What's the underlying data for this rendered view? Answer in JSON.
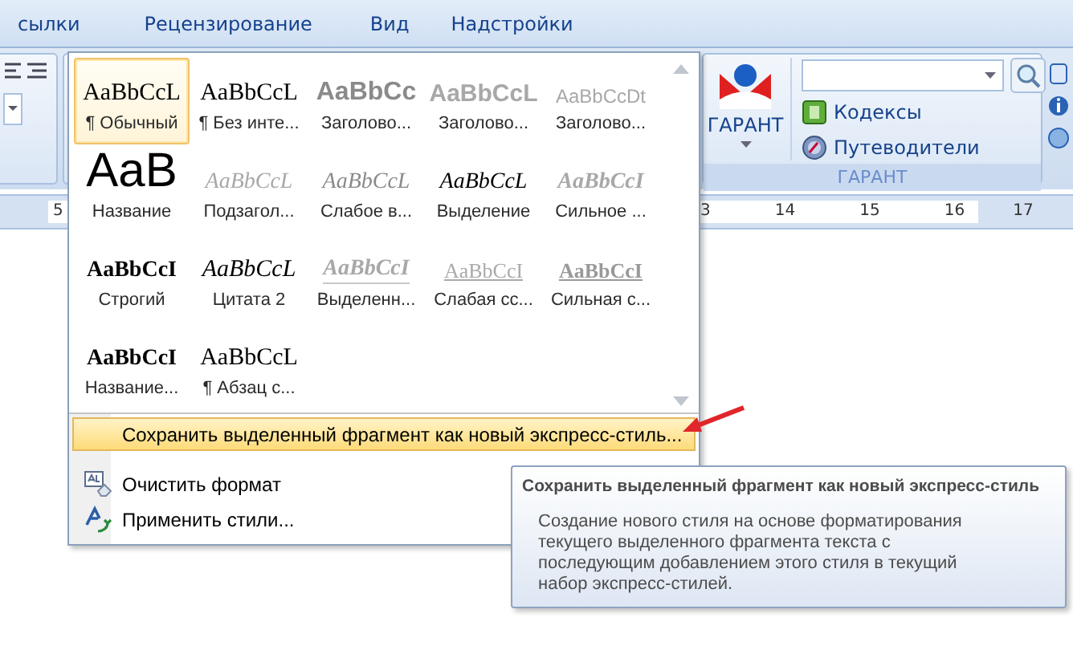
{
  "tabs": [
    {
      "label": "сылки",
      "selected": false
    },
    {
      "label": "Рецензирование",
      "selected": false
    },
    {
      "label": "Вид",
      "selected": false
    },
    {
      "label": "Надстройки",
      "selected": false
    }
  ],
  "garant_group": {
    "button_label": "ГАРАНТ",
    "links": [
      {
        "label": "Кодексы",
        "kind": "book"
      },
      {
        "label": "Путеводители",
        "kind": "compass"
      }
    ],
    "group_label": "ГАРАНТ"
  },
  "ruler": {
    "left_labels": [
      "5"
    ],
    "right_labels": [
      "3",
      "14",
      "15",
      "16",
      "17"
    ]
  },
  "style_gallery": {
    "styles": [
      {
        "preview": "AaBbCcL",
        "label": "¶ Обычный",
        "kind": "normal",
        "selected": true
      },
      {
        "preview": "AaBbCcL",
        "label": "¶ Без инте...",
        "kind": "normal",
        "selected": false
      },
      {
        "preview": "AaBbCc",
        "label": "Заголово...",
        "kind": "heading1",
        "selected": false
      },
      {
        "preview": "AaBbCcL",
        "label": "Заголово...",
        "kind": "heading2",
        "selected": false
      },
      {
        "preview": "AaBbCcDt",
        "label": "Заголово...",
        "kind": "heading3",
        "selected": false
      },
      {
        "preview": "AaB",
        "label": "Название",
        "kind": "title",
        "selected": false
      },
      {
        "preview": "AaBbCcL",
        "label": "Подзагол...",
        "kind": "subtitle",
        "selected": false
      },
      {
        "preview": "AaBbCcL",
        "label": "Слабое в...",
        "kind": "subtle-emphasis",
        "selected": false
      },
      {
        "preview": "AaBbCcL",
        "label": "Выделение",
        "kind": "emphasis",
        "selected": false
      },
      {
        "preview": "AaBbCcI",
        "label": "Сильное ...",
        "kind": "intense-emphasis",
        "selected": false
      },
      {
        "preview": "AaBbCcI",
        "label": "Строгий",
        "kind": "strong",
        "selected": false
      },
      {
        "preview": "AaBbCcL",
        "label": "Цитата 2",
        "kind": "quote",
        "selected": false
      },
      {
        "preview": "AaBbCcI",
        "label": "Выделенн...",
        "kind": "intense-quote",
        "selected": false
      },
      {
        "preview": "AaBbCcI",
        "label": "Слабая сс...",
        "kind": "subtle-reference",
        "selected": false
      },
      {
        "preview": "AaBbCcI",
        "label": "Сильная с...",
        "kind": "intense-reference",
        "selected": false
      },
      {
        "preview": "AaBbCcI",
        "label": "Название...",
        "kind": "book-title",
        "selected": false
      },
      {
        "preview": "AaBbCcL",
        "label": "¶ Абзац с...",
        "kind": "normal",
        "selected": false
      }
    ]
  },
  "menu": [
    {
      "label": "Сохранить выделенный фрагмент как новый экспресс-стиль...",
      "kind": "plain",
      "highlighted": true
    },
    {
      "label": "Очистить формат",
      "kind": "clear-format",
      "highlighted": false
    },
    {
      "label": "Применить стили...",
      "kind": "apply-styles",
      "highlighted": false
    }
  ],
  "tooltip": {
    "title": "Сохранить выделенный фрагмент как новый экспресс-стиль",
    "body": "Создание нового стиля на основе форматирования текущего выделенного фрагмента текста с последующим добавлением этого стиля в текущий набор экспресс-стилей."
  }
}
